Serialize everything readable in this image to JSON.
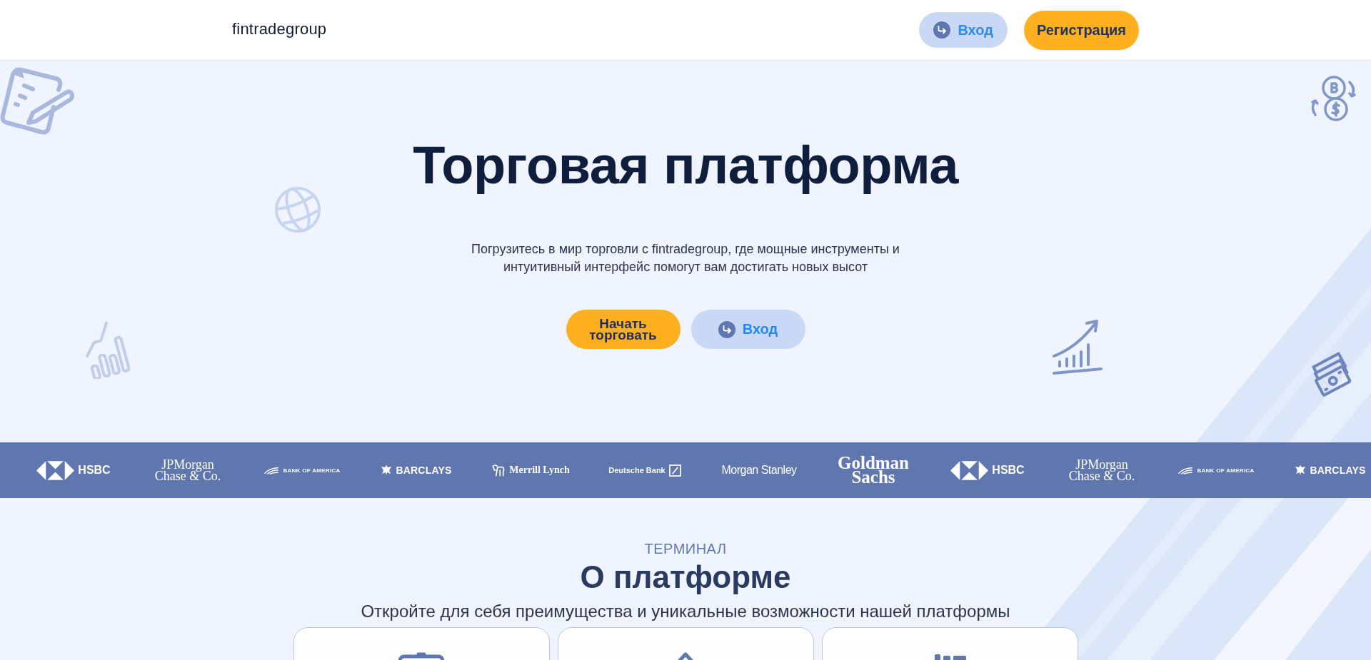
{
  "header": {
    "logo": "fintradegroup",
    "buttons": [
      {
        "label": "Вход",
        "kind": "login"
      },
      {
        "label": "Регистрация",
        "kind": "primary"
      }
    ]
  },
  "hero": {
    "title": "Торговая платформа",
    "subtitle": "Погрузитесь в мир торговли с fintradegroup, где мощные инструменты и интуитивный интерфейс помогут вам достигать новых высот",
    "buttons": [
      {
        "label": "Начать торговать",
        "kind": "primary"
      },
      {
        "label": "Вход",
        "kind": "login"
      }
    ]
  },
  "partners": [
    {
      "name": "HSBC",
      "kind": "hexagon"
    },
    {
      "name": "JPMorgan Chase & Co.",
      "kind": "serif"
    },
    {
      "name": "BANK OF AMERICA",
      "kind": "flag"
    },
    {
      "name": "BARCLAYS",
      "kind": "eagle"
    },
    {
      "name": "Merrill Lynch",
      "kind": "bull"
    },
    {
      "name": "Deutsche Bank",
      "kind": "slash-box"
    },
    {
      "name": "Morgan Stanley",
      "kind": "condensed"
    },
    {
      "name": "Goldman Sachs",
      "kind": "slab"
    },
    {
      "name": "HSBC",
      "kind": "hexagon"
    },
    {
      "name": "JPMorgan Chase & Co.",
      "kind": "serif"
    },
    {
      "name": "BANK OF AMERICA",
      "kind": "flag"
    },
    {
      "name": "BARCLAYS",
      "kind": "eagle"
    }
  ],
  "about": {
    "eyebrow": "ТЕРМИНАЛ",
    "title": "О платформе",
    "subtitle": "Откройте для себя преимущества и уникальные возможности нашей платформы",
    "cards": [
      {
        "kind": "monitor"
      },
      {
        "kind": "home"
      },
      {
        "kind": "chart"
      }
    ]
  }
}
